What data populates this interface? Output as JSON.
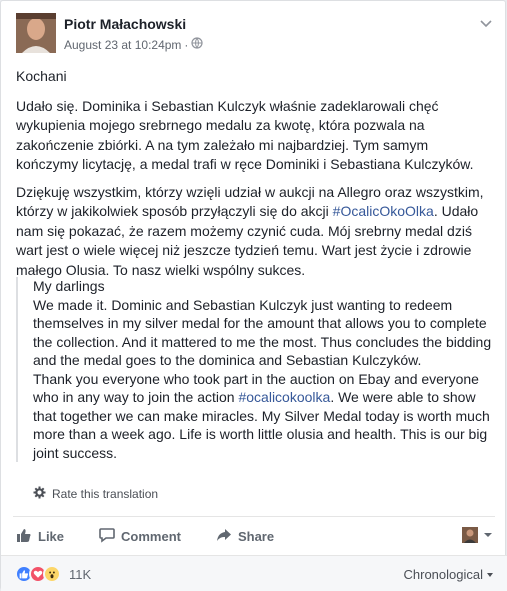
{
  "post": {
    "author": "Piotr Małachowski",
    "timestamp": "August 23 at 10:24pm",
    "separator": "·",
    "visibility_icon": "globe-icon",
    "menu_icon": "chevron-down-icon",
    "paragraphs": {
      "p1": "Kochani",
      "p2": "Udało się. Dominika i Sebastian Kulczyk właśnie zadeklarowali chęć wykupienia mojego srebrnego medalu za kwotę, która pozwala na zakończenie zbiórki. A na tym zależało mi najbardziej. Tym samym kończymy licytację, a medal trafi w ręce Dominiki i Sebastiana Kulczyków.",
      "p3_a": "Dziękuję wszystkim, którzy wzięli udział w aukcji na Allegro oraz wszystkim, którzy w jakikolwiek sposób przyłączyli się do akcji ",
      "p3_hashtag": "#OcalicOkoOlka",
      "p3_b": ". Udało nam się pokazać, że razem możemy czynić cuda. Mój srebrny medal dziś wart jest o wiele więcej niż jeszcze tydzień temu. Wart jest życie i zdrowie małego Olusia. To nasz wielki wspólny sukces."
    },
    "translation": {
      "t1": "My darlings",
      "t2": "We made it. Dominic and Sebastian Kulczyk just wanting to redeem themselves in my silver medal for the amount that allows you to complete the collection. And it mattered to me the most. Thus concludes the bidding and the medal goes to the dominica and Sebastian Kulczyków.",
      "t3_a": "Thank you everyone who took part in the auction on Ebay and everyone who in any way to join the action ",
      "t3_hashtag": "#ocalicokoolka",
      "t3_b": ". We were able to show that together we can make miracles. My Silver Medal today is worth much more than a week ago. Life is worth little olusia and health. This is our big joint success.",
      "rate_label": "Rate this translation"
    },
    "actions": {
      "like": "Like",
      "comment": "Comment",
      "share": "Share"
    },
    "footer": {
      "reactions": [
        "like-reaction-icon",
        "love-reaction-icon",
        "wow-reaction-icon"
      ],
      "count": "11K",
      "sort": "Chronological"
    },
    "colors": {
      "link": "#365899",
      "like_blue": "#4080ff",
      "love_red": "#f25268",
      "wow_yellow": "#fcd669"
    }
  }
}
